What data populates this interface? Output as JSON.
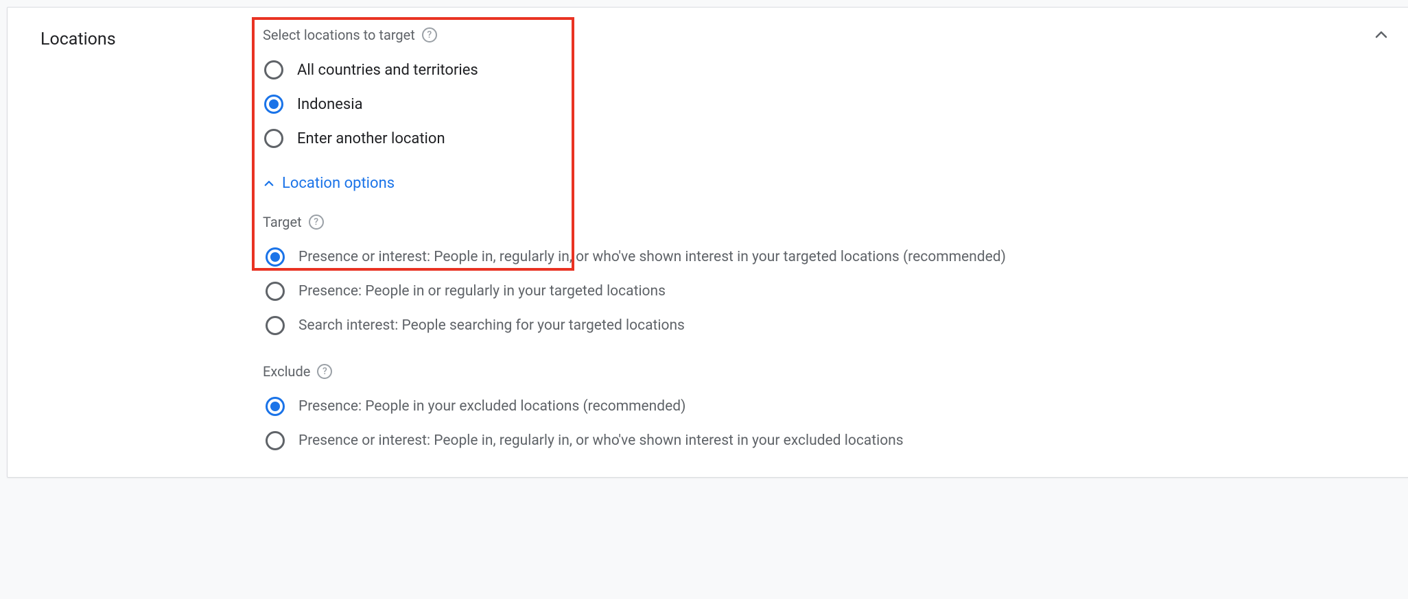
{
  "section": {
    "title": "Locations",
    "select_label": "Select locations to target",
    "location_options_link": "Location options",
    "location_radios": [
      {
        "label": "All countries and territories",
        "selected": false
      },
      {
        "label": "Indonesia",
        "selected": true
      },
      {
        "label": "Enter another location",
        "selected": false
      }
    ],
    "target": {
      "label": "Target",
      "radios": [
        {
          "label": "Presence or interest: People in, regularly in, or who've shown interest in your targeted locations (recommended)",
          "selected": true
        },
        {
          "label": "Presence: People in or regularly in your targeted locations",
          "selected": false
        },
        {
          "label": "Search interest: People searching for your targeted locations",
          "selected": false
        }
      ]
    },
    "exclude": {
      "label": "Exclude",
      "radios": [
        {
          "label": "Presence: People in your excluded locations (recommended)",
          "selected": true
        },
        {
          "label": "Presence or interest: People in, regularly in, or who've shown interest in your excluded locations",
          "selected": false
        }
      ]
    }
  }
}
